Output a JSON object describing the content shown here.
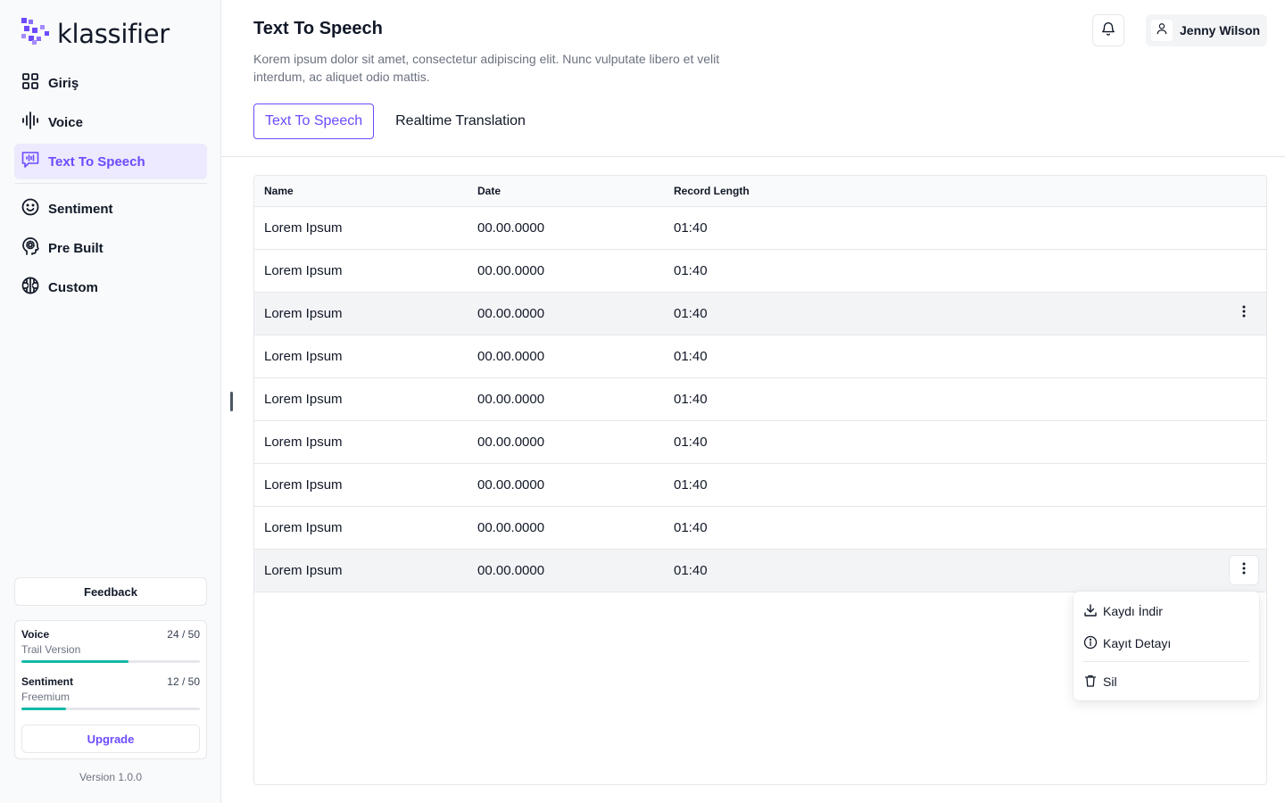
{
  "brand": {
    "name": "klassifier",
    "accent": "#6d4aff"
  },
  "sidebar": {
    "items": [
      {
        "label": "Giriş",
        "icon": "grid-icon"
      },
      {
        "label": "Voice",
        "icon": "waveform-icon"
      },
      {
        "label": "Text To Speech",
        "icon": "speech-bubble-wave-icon",
        "active": true
      },
      {
        "label": "Sentiment",
        "icon": "smiley-icon"
      },
      {
        "label": "Pre Built",
        "icon": "head-gear-icon"
      },
      {
        "label": "Custom",
        "icon": "brain-icon"
      }
    ],
    "feedback_label": "Feedback",
    "usage": [
      {
        "title": "Voice",
        "plan": "Trail Version",
        "count": "24 / 50",
        "progress": 0.6
      },
      {
        "title": "Sentiment",
        "plan": "Freemium",
        "count": "12 / 50",
        "progress": 0.25
      }
    ],
    "upgrade_label": "Upgrade",
    "version": "Version 1.0.0"
  },
  "header": {
    "title": "Text To Speech",
    "description": "Korem ipsum dolor sit amet, consectetur adipiscing elit. Nunc vulputate libero et velit interdum, ac aliquet odio mattis.",
    "user_name": "Jenny Wilson"
  },
  "tabs": [
    {
      "label": "Text To Speech",
      "active": true
    },
    {
      "label": "Realtime Translation",
      "active": false
    }
  ],
  "table": {
    "columns": [
      "Name",
      "Date",
      "Record Length"
    ],
    "rows": [
      {
        "name": "Lorem Ipsum",
        "date": "00.00.0000",
        "length": "01:40"
      },
      {
        "name": "Lorem Ipsum",
        "date": "00.00.0000",
        "length": "01:40"
      },
      {
        "name": "Lorem Ipsum",
        "date": "00.00.0000",
        "length": "01:40",
        "hover": true
      },
      {
        "name": "Lorem Ipsum",
        "date": "00.00.0000",
        "length": "01:40"
      },
      {
        "name": "Lorem Ipsum",
        "date": "00.00.0000",
        "length": "01:40"
      },
      {
        "name": "Lorem Ipsum",
        "date": "00.00.0000",
        "length": "01:40"
      },
      {
        "name": "Lorem Ipsum",
        "date": "00.00.0000",
        "length": "01:40"
      },
      {
        "name": "Lorem Ipsum",
        "date": "00.00.0000",
        "length": "01:40"
      },
      {
        "name": "Lorem Ipsum",
        "date": "00.00.0000",
        "length": "01:40",
        "hover": true,
        "menu_open": true
      }
    ]
  },
  "row_menu": {
    "items": [
      {
        "label": "Kaydı İndir",
        "icon": "download-icon"
      },
      {
        "label": "Kayıt Detayı",
        "icon": "info-icon"
      },
      {
        "label": "Sil",
        "icon": "trash-icon"
      }
    ]
  }
}
